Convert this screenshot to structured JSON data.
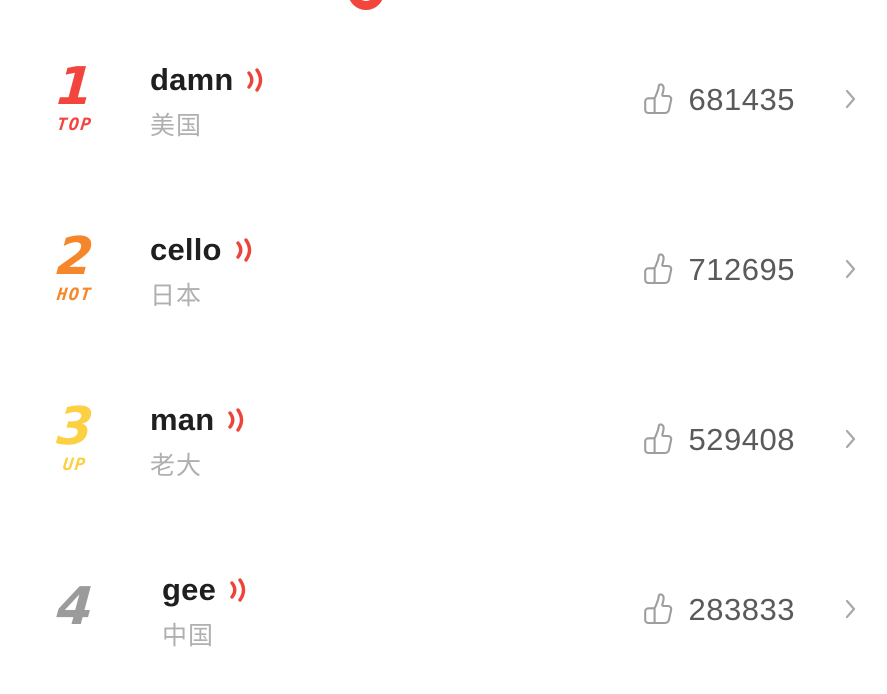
{
  "screen": {
    "background_color": "#ffffff",
    "partial_top_logo": {
      "icon": "letter-o-fragment",
      "color": "#F2453D"
    }
  },
  "colors": {
    "rank1": "#F2453D",
    "rank2": "#F5862A",
    "rank3": "#FBD042",
    "rank4": "#9B9B9B",
    "title": "#1f1f1f",
    "subtitle": "#b0b0b0",
    "count": "#5a5a5a",
    "sound_icon": "#EE4338",
    "thumb_icon": "#9e9e9e",
    "chevron": "#a8a8a8"
  },
  "icons": {
    "sound": "sound-wave-icon",
    "thumb": "thumbs-up-icon",
    "chevron": "chevron-right-icon"
  },
  "list": {
    "rows": [
      {
        "rank": "1",
        "tag": "TOP",
        "tag_visible": true,
        "rank_color": "#F2453D",
        "title": "damn",
        "subtitle": "美国",
        "likes": "681435",
        "indented": false
      },
      {
        "rank": "2",
        "tag": "HOT",
        "tag_visible": true,
        "rank_color": "#F5862A",
        "title": "cello",
        "subtitle": "日本",
        "likes": "712695",
        "indented": false
      },
      {
        "rank": "3",
        "tag": "UP",
        "tag_visible": true,
        "rank_color": "#FBD042",
        "title": "man",
        "subtitle": "老大",
        "likes": "529408",
        "indented": false
      },
      {
        "rank": "4",
        "tag": "",
        "tag_visible": false,
        "rank_color": "#9B9B9B",
        "title": "gee",
        "subtitle": "中国",
        "likes": "283833",
        "indented": true
      }
    ]
  }
}
